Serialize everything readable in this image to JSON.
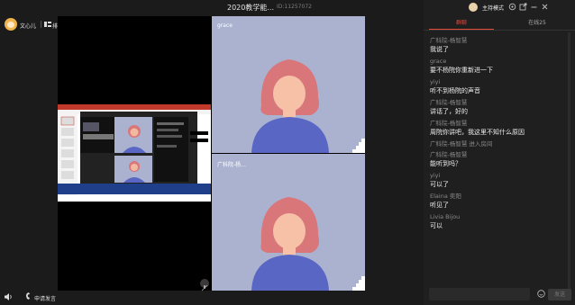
{
  "meeting": {
    "title": "2020教学能...",
    "id_text": "ID:11257072"
  },
  "user": {
    "name": "文心儿",
    "layout_label": "排麦"
  },
  "host": {
    "label": "主持模式"
  },
  "stage": {
    "tile1_label": "grace",
    "tile2_label": "广科院-杨..."
  },
  "bottom": {
    "apply_label": "申请发言"
  },
  "chat": {
    "tab_chat": "群聊",
    "tab_online": "在线25",
    "send_label": "发送",
    "messages": [
      {
        "sender": "广科院-杨智慧",
        "text": "我说了"
      },
      {
        "sender": "grace",
        "text": "要不杨院你重新进一下"
      },
      {
        "sender": "yiyi",
        "text": "听不到杨院的声音"
      },
      {
        "sender": "广科院-杨智慧",
        "text": "讲话了，好的"
      },
      {
        "sender": "广科院-杨智慧",
        "text": "周院你讲吧，我这里不知什么原因"
      },
      {
        "sender": "广科院-杨智慧 进入房间",
        "text": ""
      },
      {
        "sender": "广科院-杨智慧",
        "text": "能听到吗？"
      },
      {
        "sender": "yiyi",
        "text": "可以了"
      },
      {
        "sender": "Elaina 奕阳",
        "text": "听见了"
      },
      {
        "sender": "Livia Bijou",
        "text": "可以"
      }
    ]
  },
  "colors": {
    "accent": "#e24a3a",
    "video_bg": "#aab2cf",
    "person_hair": "#d9767a",
    "person_shirt": "#5a66c4"
  },
  "icons": [
    "layout-icon",
    "settings-icon",
    "share-icon",
    "minimize-icon",
    "close-icon",
    "volume-icon",
    "apply-speak-icon",
    "emoji-icon",
    "mic-off-icon"
  ]
}
